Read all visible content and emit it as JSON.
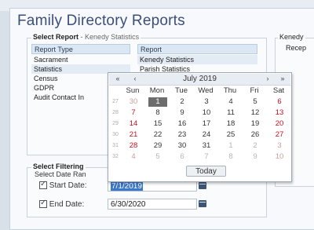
{
  "page_title": "Family Directory Reports",
  "select_report": {
    "legend_bold": "Select Report",
    "legend_rest": "- Kenedy Statistics",
    "type_header": "Report Type",
    "report_header": "Report",
    "types": [
      "Sacrament",
      "Statistics",
      "Census",
      "GDPR",
      "Audit Contact In"
    ],
    "reports": [
      "Kenedy Statistics",
      "Parish Statistics"
    ]
  },
  "right_group": {
    "legend": "Kenedy",
    "sub": "Recep"
  },
  "filtering": {
    "legend": "Select Filtering",
    "date_range_label": "Select Date Ran",
    "start_label": "Start Date:",
    "start_value": "7/1/2019",
    "end_label": "End Date:",
    "end_value": "6/30/2020"
  },
  "calendar": {
    "prev_year": "«",
    "prev_month": "‹",
    "month_title": "July 2019",
    "next_month": "›",
    "next_year": "»",
    "day_names": [
      "Sun",
      "Mon",
      "Tue",
      "Wed",
      "Thu",
      "Fri",
      "Sat"
    ],
    "weeks": [
      {
        "wk": "27",
        "days": [
          "30",
          "1",
          "2",
          "3",
          "4",
          "5",
          "6"
        ]
      },
      {
        "wk": "28",
        "days": [
          "7",
          "8",
          "9",
          "10",
          "11",
          "12",
          "13"
        ]
      },
      {
        "wk": "29",
        "days": [
          "14",
          "15",
          "16",
          "17",
          "18",
          "19",
          "20"
        ]
      },
      {
        "wk": "30",
        "days": [
          "21",
          "22",
          "23",
          "24",
          "25",
          "26",
          "27"
        ]
      },
      {
        "wk": "31",
        "days": [
          "28",
          "29",
          "30",
          "31",
          "1",
          "2",
          "3"
        ]
      },
      {
        "wk": "32",
        "days": [
          "4",
          "5",
          "6",
          "7",
          "8",
          "9",
          "10"
        ]
      }
    ],
    "today_label": "Today"
  }
}
